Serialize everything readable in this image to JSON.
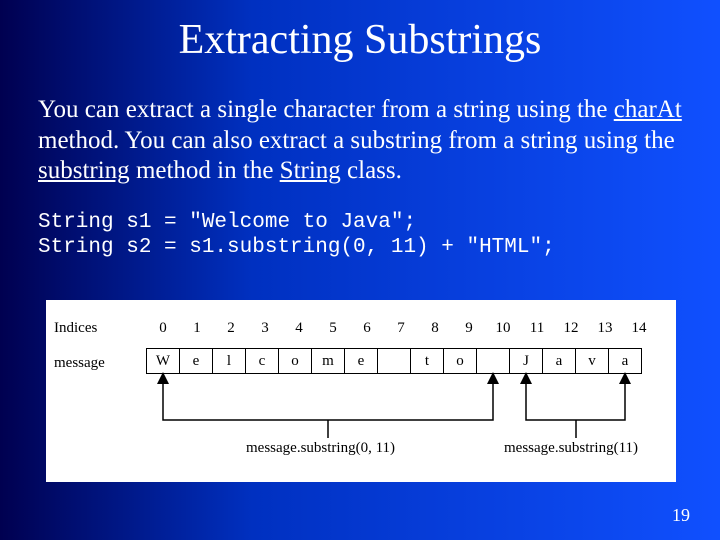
{
  "title": "Extracting Substrings",
  "body": {
    "pre1": "You can extract a single character from a string using the ",
    "u1": "charAt",
    "mid1": " method. You can also extract a substring from a string using the ",
    "u2": "substring",
    "mid2": " method in the ",
    "u3": "String",
    "post": " class."
  },
  "code": {
    "line1": "String s1 = \"Welcome to Java\";",
    "line2": "String s2 = s1.substring(0, 11) + \"HTML\";"
  },
  "diagram": {
    "indices_label": "Indices",
    "message_label": "message",
    "indices": [
      "0",
      "1",
      "2",
      "3",
      "4",
      "5",
      "6",
      "7",
      "8",
      "9",
      "10",
      "11",
      "12",
      "13",
      "14"
    ],
    "chars": [
      "W",
      "e",
      "l",
      "c",
      "o",
      "m",
      "e",
      " ",
      "t",
      "o",
      " ",
      "J",
      "a",
      "v",
      "a"
    ],
    "annotation_left": "message.substring(0, 11)",
    "annotation_right": "message.substring(11)"
  },
  "page_number": "19"
}
